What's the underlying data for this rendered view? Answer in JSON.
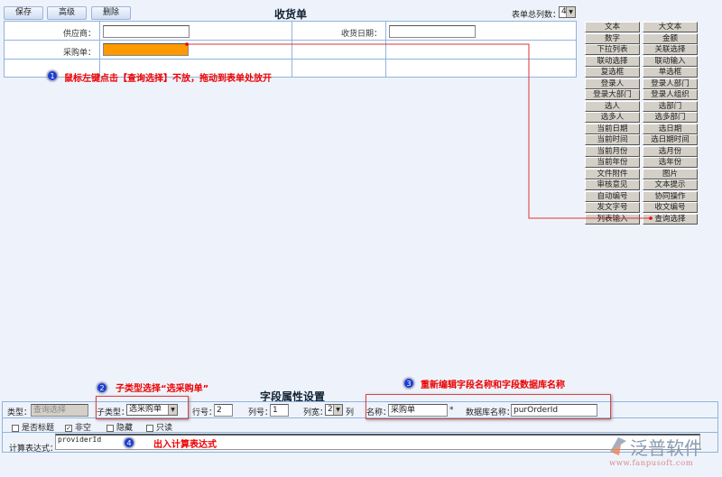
{
  "toolbar": {
    "save": "保存",
    "advanced": "高级",
    "delete": "删除"
  },
  "form": {
    "title": "收货单",
    "total_cols_label": "表单总列数：",
    "total_cols_value": "4",
    "supplier_label": "供应商：",
    "supplier_value": "",
    "receive_date_label": "收货日期：",
    "receive_date_value": "",
    "po_label": "采购单：",
    "po_value": ""
  },
  "palette": [
    [
      "文本",
      "大文本"
    ],
    [
      "数字",
      "金额"
    ],
    [
      "下拉列表",
      "关联选择"
    ],
    [
      "联动选择",
      "联动输入"
    ],
    [
      "复选框",
      "单选框"
    ],
    [
      "登录人",
      "登录人部门"
    ],
    [
      "登录大部门",
      "登录人组织"
    ],
    [
      "选人",
      "选部门"
    ],
    [
      "选多人",
      "选多部门"
    ],
    [
      "当前日期",
      "选日期"
    ],
    [
      "当前时间",
      "选日期时间"
    ],
    [
      "当前月份",
      "选月份"
    ],
    [
      "当前年份",
      "选年份"
    ],
    [
      "文件附件",
      "图片"
    ],
    [
      "审核意见",
      "文本提示"
    ],
    [
      "自动编号",
      "协同操作"
    ],
    [
      "发文字号",
      "收文编号"
    ],
    [
      "列表输入",
      "查询选择"
    ]
  ],
  "annotations": {
    "n1": "1",
    "t1": "鼠标左键点击【查询选择】不放，拖动到表单处放开",
    "n2": "2",
    "t2": "子类型选择“选采购单”",
    "n3": "3",
    "t3": "重新编辑字段名称和字段数据库名称",
    "n4": "4",
    "t4": "出入计算表达式"
  },
  "props": {
    "title": "字段属性设置",
    "type_label": "类型：",
    "type_value": "查询选择",
    "subtype_label": "子类型：",
    "subtype_value": "选采购单",
    "row_label": "行号：",
    "row_value": "2",
    "col_label": "列号：",
    "col_value": "1",
    "width_label": "列宽：",
    "width_value": "2",
    "width_unit": "列",
    "name_label": "名称：",
    "name_value": "采购单",
    "required_mark": "*",
    "db_label": "数据库名称：",
    "db_value": "purOrderId",
    "cb_title": "是否标题",
    "cb_notnull": "非空",
    "cb_hidden": "隐藏",
    "cb_readonly": "只读",
    "check_mark": "✓",
    "expr_label": "计算表达式：",
    "expr_value": "providerId"
  },
  "logo": {
    "name": "泛普软件",
    "url": "www.fanpusoft.com"
  },
  "colors": {
    "accent_orange": "#ff9900",
    "annotation_red": "#e00000"
  }
}
